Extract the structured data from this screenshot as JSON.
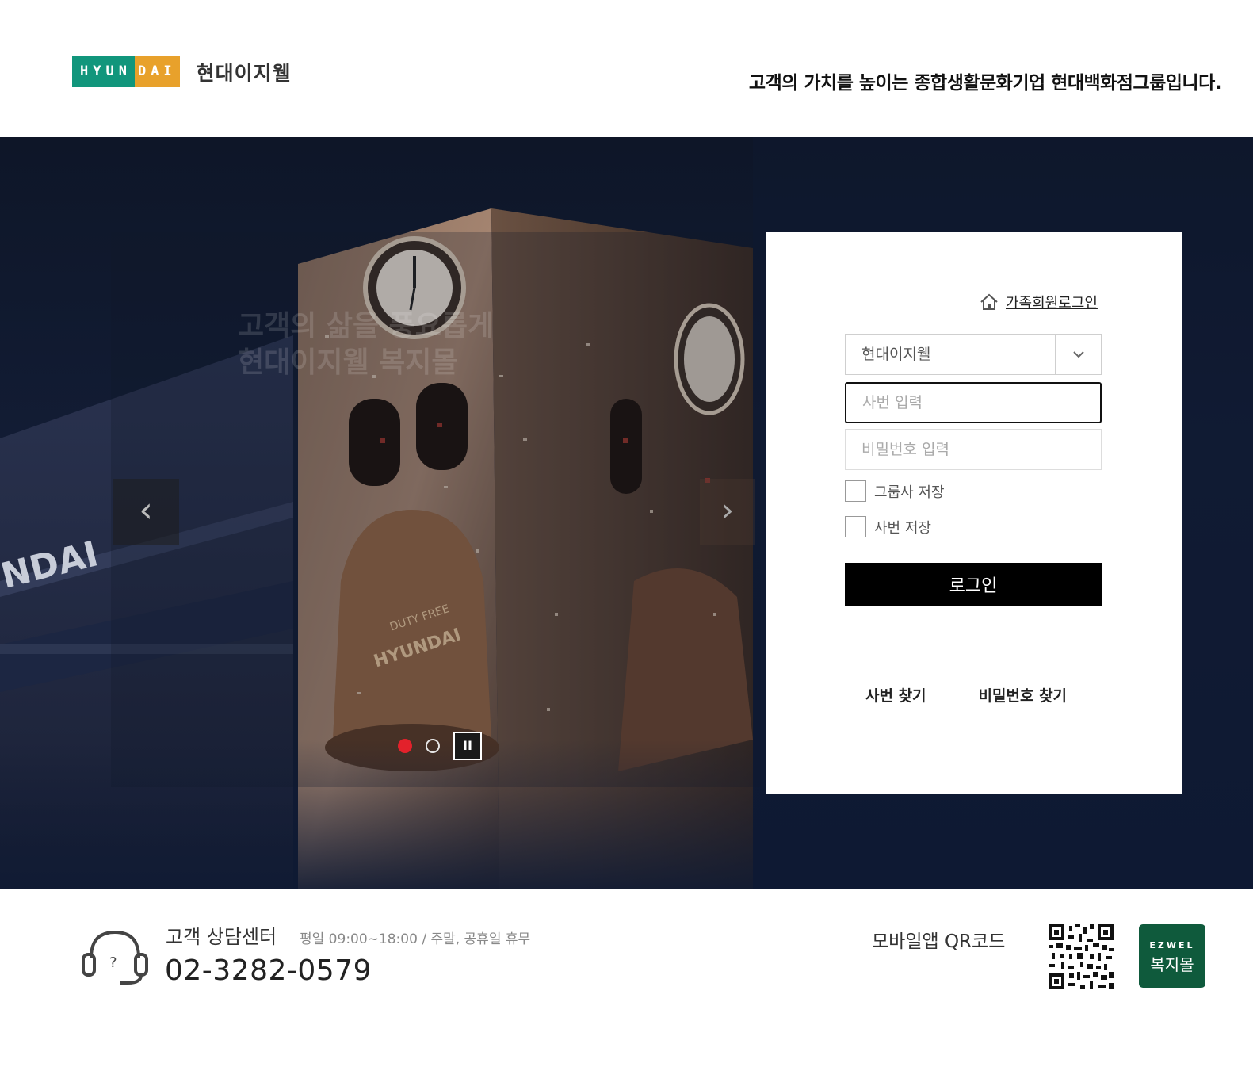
{
  "header": {
    "logo_badge_green": "HYUN",
    "logo_badge_orange": "DAI",
    "logo_name": "현대이지웰",
    "tagline": "고객의 가치를 높이는 종합생활문화기업 현대백화점그룹입니다."
  },
  "hero": {
    "faded_line1": "고객의 삶을 풍요롭게",
    "faded_line2": "현대이지웰 복지몰",
    "prev_label": "‹",
    "next_label": "›",
    "pause_label": "II",
    "slide_count": 2,
    "active_slide": 1
  },
  "login": {
    "family_link": "가족회원로그인",
    "company_select": "현대이지웰",
    "id_placeholder": "사번 입력",
    "pw_placeholder": "비밀번호 입력",
    "save_group": "그룹사 저장",
    "save_id": "사번 저장",
    "login_button": "로그인",
    "find_id": "사번 찾기",
    "find_pw": "비밀번호 찾기"
  },
  "footer": {
    "cs_title": "고객 상담센터",
    "cs_hours": "평일 09:00~18:00 / 주말, 공휴일 휴무",
    "cs_phone": "02-3282-0579",
    "qr_label": "모바일앱 QR코드",
    "ezwel_top": "EZWEL",
    "ezwel_bottom": "복지몰"
  },
  "colors": {
    "brand_green": "#11967c",
    "brand_orange": "#e8a12b",
    "dot_active": "#e3212b",
    "ezwel_green": "#0f5a3c"
  }
}
